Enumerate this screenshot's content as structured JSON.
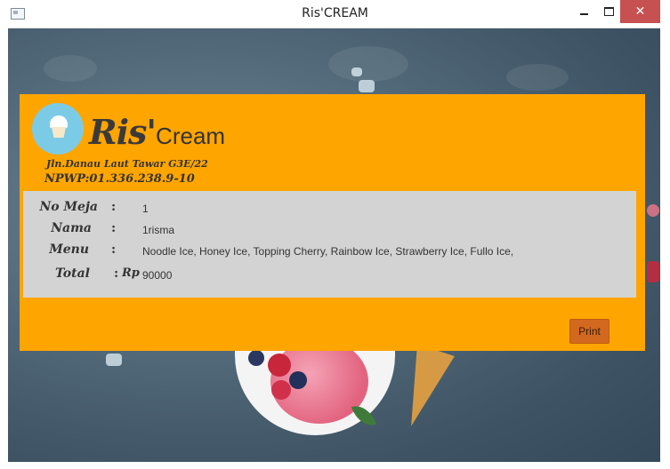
{
  "window": {
    "title": "Ris'CREAM",
    "close_glyph": "✕"
  },
  "brand": {
    "name_part1": "Ris'",
    "name_part2": "Cream",
    "address": "Jln.Danau Laut Tawar G3E/22",
    "npwp": "NPWP:01.336.238.9-10"
  },
  "receipt": {
    "no_meja_label": "No Meja",
    "no_meja_value": "1",
    "nama_label": "Nama",
    "nama_value": "1risma",
    "menu_label": "Menu",
    "menu_value": "Noodle Ice, Honey Ice, Topping Cherry, Rainbow Ice, Strawberry Ice, Fullo Ice,",
    "total_label": "Total",
    "total_currency": "Rp",
    "total_value": "90000",
    "colon": ":"
  },
  "actions": {
    "print_label": "Print"
  },
  "colors": {
    "panel": "#ffa500",
    "info_box": "#d3d3d3",
    "print_button": "#d2691e",
    "logo_circle": "#7ccbe6",
    "close_button": "#c75050"
  }
}
